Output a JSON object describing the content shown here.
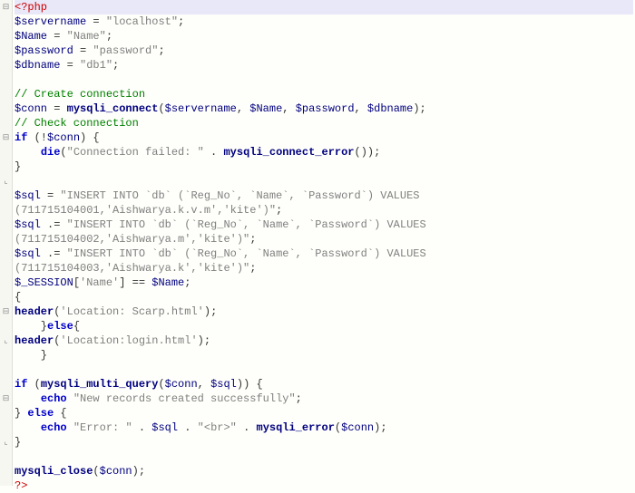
{
  "folds": [
    "⊟",
    "",
    "",
    "",
    "",
    "",
    "",
    "",
    "",
    "⊟",
    "",
    "",
    "⌞",
    "",
    "",
    "",
    "",
    "",
    "",
    "",
    "",
    "⊟",
    "",
    "⌞",
    "",
    "",
    "",
    "⊟",
    "",
    "",
    "⌞",
    "",
    "",
    "",
    "",
    ""
  ],
  "lines": [
    [
      {
        "c": "k-red",
        "t": "<?php"
      }
    ],
    [
      {
        "c": "k-var",
        "t": "$servername"
      },
      {
        "c": "k-text",
        "t": " = "
      },
      {
        "c": "k-str",
        "t": "\"localhost\""
      },
      {
        "c": "k-text",
        "t": ";"
      }
    ],
    [
      {
        "c": "k-var",
        "t": "$Name"
      },
      {
        "c": "k-text",
        "t": " = "
      },
      {
        "c": "k-str",
        "t": "\"Name\""
      },
      {
        "c": "k-text",
        "t": ";"
      }
    ],
    [
      {
        "c": "k-var",
        "t": "$password"
      },
      {
        "c": "k-text",
        "t": " = "
      },
      {
        "c": "k-str",
        "t": "\"password\""
      },
      {
        "c": "k-text",
        "t": ";"
      }
    ],
    [
      {
        "c": "k-var",
        "t": "$dbname"
      },
      {
        "c": "k-text",
        "t": " = "
      },
      {
        "c": "k-str",
        "t": "\"db1\""
      },
      {
        "c": "k-text",
        "t": ";"
      }
    ],
    [
      {
        "c": "",
        "t": ""
      }
    ],
    [
      {
        "c": "k-comment",
        "t": "// Create connection"
      }
    ],
    [
      {
        "c": "k-var",
        "t": "$conn"
      },
      {
        "c": "k-text",
        "t": " = "
      },
      {
        "c": "k-func",
        "t": "mysqli_connect"
      },
      {
        "c": "k-paren",
        "t": "("
      },
      {
        "c": "k-var",
        "t": "$servername"
      },
      {
        "c": "k-text",
        "t": ", "
      },
      {
        "c": "k-var",
        "t": "$Name"
      },
      {
        "c": "k-text",
        "t": ", "
      },
      {
        "c": "k-var",
        "t": "$password"
      },
      {
        "c": "k-text",
        "t": ", "
      },
      {
        "c": "k-var",
        "t": "$dbname"
      },
      {
        "c": "k-paren",
        "t": ")"
      },
      {
        "c": "k-text",
        "t": ";"
      }
    ],
    [
      {
        "c": "k-comment",
        "t": "// Check connection"
      }
    ],
    [
      {
        "c": "k-blue",
        "t": "if"
      },
      {
        "c": "k-text",
        "t": " (!"
      },
      {
        "c": "k-var",
        "t": "$conn"
      },
      {
        "c": "k-text",
        "t": ") {"
      }
    ],
    [
      {
        "c": "k-text",
        "t": "    "
      },
      {
        "c": "k-blue",
        "t": "die"
      },
      {
        "c": "k-paren",
        "t": "("
      },
      {
        "c": "k-str",
        "t": "\"Connection failed: \""
      },
      {
        "c": "k-text",
        "t": " . "
      },
      {
        "c": "k-func",
        "t": "mysqli_connect_error"
      },
      {
        "c": "k-paren",
        "t": "())"
      },
      {
        "c": "k-text",
        "t": ";"
      }
    ],
    [
      {
        "c": "k-text",
        "t": "}"
      }
    ],
    [
      {
        "c": "",
        "t": ""
      }
    ],
    [
      {
        "c": "k-var",
        "t": "$sql"
      },
      {
        "c": "k-text",
        "t": " = "
      },
      {
        "c": "k-str",
        "t": "\"INSERT INTO `db` (`Reg_No`, `Name`, `Password`) VALUES"
      }
    ],
    [
      {
        "c": "k-str",
        "t": "(711715104001,'Aishwarya.k.v.m','kite')\""
      },
      {
        "c": "k-text",
        "t": ";"
      }
    ],
    [
      {
        "c": "k-var",
        "t": "$sql"
      },
      {
        "c": "k-text",
        "t": " .= "
      },
      {
        "c": "k-str",
        "t": "\"INSERT INTO `db` (`Reg_No`, `Name`, `Password`) VALUES"
      }
    ],
    [
      {
        "c": "k-str",
        "t": "(711715104002,'Aishwarya.m','kite')\""
      },
      {
        "c": "k-text",
        "t": ";"
      }
    ],
    [
      {
        "c": "k-var",
        "t": "$sql"
      },
      {
        "c": "k-text",
        "t": " .= "
      },
      {
        "c": "k-str",
        "t": "\"INSERT INTO `db` (`Reg_No`, `Name`, `Password`) VALUES"
      }
    ],
    [
      {
        "c": "k-str",
        "t": "(711715104003,'Aishwarya.k','kite')\""
      },
      {
        "c": "k-text",
        "t": ";"
      }
    ],
    [
      {
        "c": "k-var",
        "t": "$_SESSION"
      },
      {
        "c": "k-text",
        "t": "["
      },
      {
        "c": "k-str",
        "t": "'Name'"
      },
      {
        "c": "k-text",
        "t": "] == "
      },
      {
        "c": "k-var",
        "t": "$Name"
      },
      {
        "c": "k-text",
        "t": ";"
      }
    ],
    [
      {
        "c": "k-text",
        "t": "{"
      }
    ],
    [
      {
        "c": "k-func",
        "t": "header"
      },
      {
        "c": "k-paren",
        "t": "("
      },
      {
        "c": "k-str",
        "t": "'Location: Scarp.html'"
      },
      {
        "c": "k-paren",
        "t": ")"
      },
      {
        "c": "k-text",
        "t": ";"
      }
    ],
    [
      {
        "c": "k-text",
        "t": "    }"
      },
      {
        "c": "k-blue",
        "t": "else"
      },
      {
        "c": "k-text",
        "t": "{"
      }
    ],
    [
      {
        "c": "k-func",
        "t": "header"
      },
      {
        "c": "k-paren",
        "t": "("
      },
      {
        "c": "k-str",
        "t": "'Location:login.html'"
      },
      {
        "c": "k-paren",
        "t": ")"
      },
      {
        "c": "k-text",
        "t": ";"
      }
    ],
    [
      {
        "c": "k-text",
        "t": "    }"
      }
    ],
    [
      {
        "c": "",
        "t": ""
      }
    ],
    [
      {
        "c": "k-blue",
        "t": "if"
      },
      {
        "c": "k-text",
        "t": " ("
      },
      {
        "c": "k-func",
        "t": "mysqli_multi_query"
      },
      {
        "c": "k-paren",
        "t": "("
      },
      {
        "c": "k-var",
        "t": "$conn"
      },
      {
        "c": "k-text",
        "t": ", "
      },
      {
        "c": "k-var",
        "t": "$sql"
      },
      {
        "c": "k-paren",
        "t": "))"
      },
      {
        "c": "k-text",
        "t": " {"
      }
    ],
    [
      {
        "c": "k-text",
        "t": "    "
      },
      {
        "c": "k-blue",
        "t": "echo"
      },
      {
        "c": "k-text",
        "t": " "
      },
      {
        "c": "k-str",
        "t": "\"New records created successfully\""
      },
      {
        "c": "k-text",
        "t": ";"
      }
    ],
    [
      {
        "c": "k-text",
        "t": "} "
      },
      {
        "c": "k-blue",
        "t": "else"
      },
      {
        "c": "k-text",
        "t": " {"
      }
    ],
    [
      {
        "c": "k-text",
        "t": "    "
      },
      {
        "c": "k-blue",
        "t": "echo"
      },
      {
        "c": "k-text",
        "t": " "
      },
      {
        "c": "k-str",
        "t": "\"Error: \""
      },
      {
        "c": "k-text",
        "t": " . "
      },
      {
        "c": "k-var",
        "t": "$sql"
      },
      {
        "c": "k-text",
        "t": " . "
      },
      {
        "c": "k-str",
        "t": "\"<br>\""
      },
      {
        "c": "k-text",
        "t": " . "
      },
      {
        "c": "k-func",
        "t": "mysqli_error"
      },
      {
        "c": "k-paren",
        "t": "("
      },
      {
        "c": "k-var",
        "t": "$conn"
      },
      {
        "c": "k-paren",
        "t": ")"
      },
      {
        "c": "k-text",
        "t": ";"
      }
    ],
    [
      {
        "c": "k-text",
        "t": "}"
      }
    ],
    [
      {
        "c": "",
        "t": ""
      }
    ],
    [
      {
        "c": "k-func",
        "t": "mysqli_close"
      },
      {
        "c": "k-paren",
        "t": "("
      },
      {
        "c": "k-var",
        "t": "$conn"
      },
      {
        "c": "k-paren",
        "t": ")"
      },
      {
        "c": "k-text",
        "t": ";"
      }
    ],
    [
      {
        "c": "k-red",
        "t": "?>"
      }
    ]
  ],
  "highlighted_line": 0
}
